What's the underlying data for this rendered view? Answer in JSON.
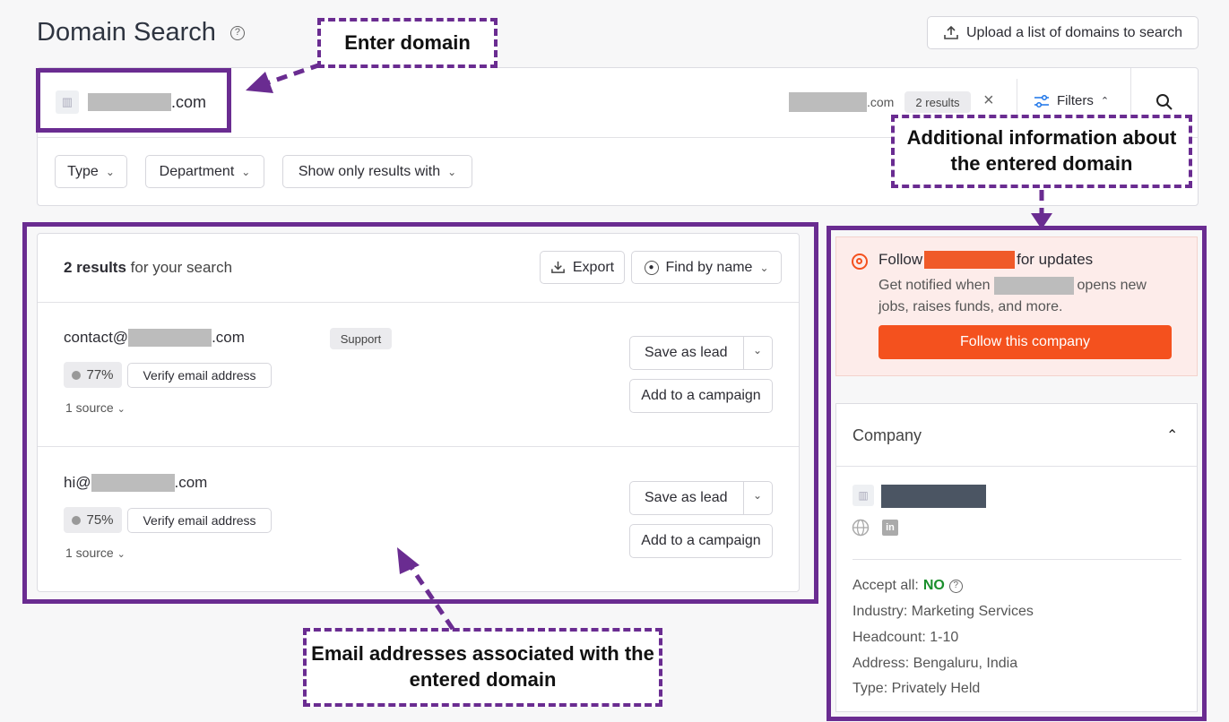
{
  "header": {
    "title": "Domain Search",
    "upload_label": "Upload a list of domains to search"
  },
  "search": {
    "domain_suffix": ".com",
    "right_suffix": ".com",
    "results_badge": "2 results",
    "clear_icon": "×",
    "filters_label": "Filters"
  },
  "filters": [
    {
      "label": "Type"
    },
    {
      "label": "Department"
    },
    {
      "label": "Show only results with"
    }
  ],
  "results": {
    "count_bold": "2 results",
    "count_rest": " for your search",
    "export_label": "Export",
    "find_by_name_label": "Find by name",
    "items": [
      {
        "prefix": "contact@",
        "suffix": ".com",
        "tag": "Support",
        "score": "77%",
        "verify_label": "Verify email address",
        "source_label": "1 source",
        "save_label": "Save as lead",
        "campaign_label": "Add to a campaign"
      },
      {
        "prefix": "hi@",
        "suffix": ".com",
        "tag": "",
        "score": "75%",
        "verify_label": "Verify email address",
        "source_label": "1 source",
        "save_label": "Save as lead",
        "campaign_label": "Add to a campaign"
      }
    ]
  },
  "follow": {
    "title_pre": "Follow",
    "title_post": "for updates",
    "desc_pre": "Get notified when",
    "desc_post": "opens new",
    "desc_line2": "jobs, raises funds, and more.",
    "button_label": "Follow this company",
    "accent_color": "#f4511e"
  },
  "company": {
    "section_title": "Company",
    "accept_all_label": "Accept all:",
    "accept_all_value": "NO",
    "industry": "Industry: Marketing Services",
    "headcount": "Headcount: 1-10",
    "address": "Address: Bengaluru, India",
    "type": "Type: Privately Held"
  },
  "annotations": {
    "enter_domain": "Enter domain",
    "additional_info": "Additional information about the entered domain",
    "emails_associated": "Email addresses associated with the entered domain",
    "frame_color": "#6a2c91"
  }
}
